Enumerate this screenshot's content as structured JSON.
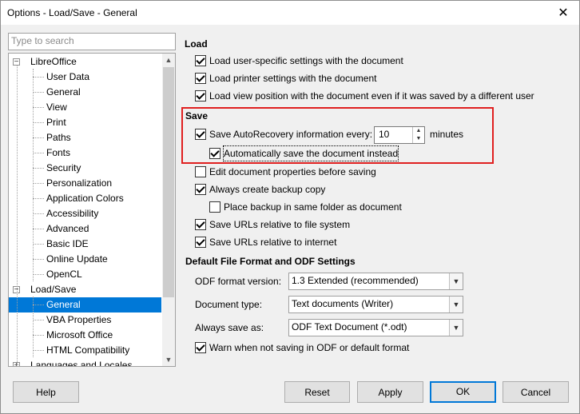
{
  "window": {
    "title": "Options - Load/Save - General",
    "close_glyph": "✕"
  },
  "search": {
    "placeholder": "Type to search"
  },
  "tree": {
    "items": [
      {
        "label": "LibreOffice",
        "level": 0,
        "expander": "−"
      },
      {
        "label": "User Data",
        "level": 1
      },
      {
        "label": "General",
        "level": 1
      },
      {
        "label": "View",
        "level": 1
      },
      {
        "label": "Print",
        "level": 1
      },
      {
        "label": "Paths",
        "level": 1
      },
      {
        "label": "Fonts",
        "level": 1
      },
      {
        "label": "Security",
        "level": 1
      },
      {
        "label": "Personalization",
        "level": 1
      },
      {
        "label": "Application Colors",
        "level": 1
      },
      {
        "label": "Accessibility",
        "level": 1
      },
      {
        "label": "Advanced",
        "level": 1
      },
      {
        "label": "Basic IDE",
        "level": 1
      },
      {
        "label": "Online Update",
        "level": 1
      },
      {
        "label": "OpenCL",
        "level": 1
      },
      {
        "label": "Load/Save",
        "level": 0,
        "expander": "−"
      },
      {
        "label": "General",
        "level": 1,
        "selected": true
      },
      {
        "label": "VBA Properties",
        "level": 1
      },
      {
        "label": "Microsoft Office",
        "level": 1
      },
      {
        "label": "HTML Compatibility",
        "level": 1
      },
      {
        "label": "Languages and Locales",
        "level": 0,
        "expander": "+"
      }
    ]
  },
  "load": {
    "title": "Load",
    "options": [
      {
        "label": "Load user-specific settings with the document",
        "checked": true
      },
      {
        "label": "Load printer settings with the document",
        "checked": true
      },
      {
        "label": "Load view position with the document even if it was saved by a different user",
        "checked": true
      }
    ]
  },
  "save": {
    "title": "Save",
    "autorecovery_label": "Save AutoRecovery information every:",
    "autorecovery_checked": true,
    "autorecovery_value": "10",
    "autorecovery_unit": "minutes",
    "auto_save_label": "Automatically save the document instead",
    "auto_save_checked": true,
    "edit_props_label": "Edit document properties before saving",
    "edit_props_checked": false,
    "backup_label": "Always create backup copy",
    "backup_checked": true,
    "backup_same_folder_label": "Place backup in same folder as document",
    "backup_same_folder_checked": false,
    "urls_fs_label": "Save URLs relative to file system",
    "urls_fs_checked": true,
    "urls_inet_label": "Save URLs relative to internet",
    "urls_inet_checked": true
  },
  "format": {
    "title": "Default File Format and ODF Settings",
    "odf_version_label": "ODF format version:",
    "odf_version_value": "1.3 Extended (recommended)",
    "doc_type_label": "Document type:",
    "doc_type_value": "Text documents (Writer)",
    "always_save_label": "Always save as:",
    "always_save_value": "ODF Text Document (*.odt)",
    "warn_label": "Warn when not saving in ODF or default format",
    "warn_checked": true
  },
  "buttons": {
    "help": "Help",
    "reset": "Reset",
    "apply": "Apply",
    "ok": "OK",
    "cancel": "Cancel"
  },
  "colors": {
    "selection": "#0078d7",
    "highlight_border": "#e02020",
    "default_button_border": "#0078d7"
  }
}
